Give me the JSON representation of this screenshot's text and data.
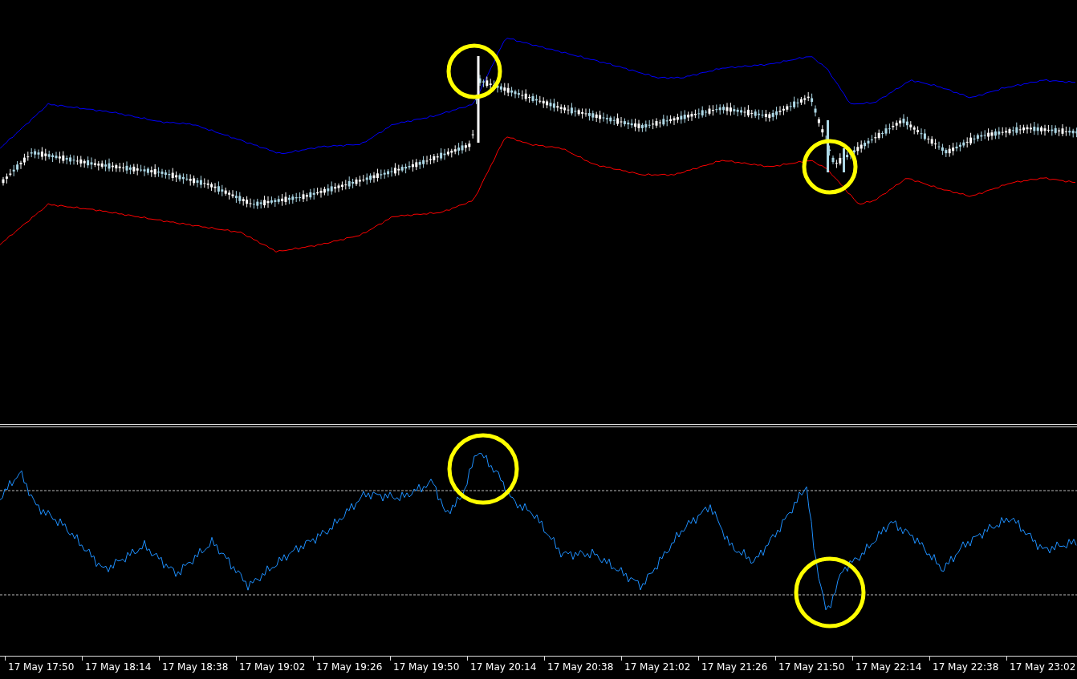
{
  "time_axis": {
    "labels": [
      "17 May 17:50",
      "17 May 18:14",
      "17 May 18:38",
      "17 May 19:02",
      "17 May 19:26",
      "17 May 19:50",
      "17 May 20:14",
      "17 May 20:38",
      "17 May 21:02",
      "17 May 21:26",
      "17 May 21:50",
      "17 May 22:14",
      "17 May 22:38",
      "17 May 23:02"
    ]
  }
}
